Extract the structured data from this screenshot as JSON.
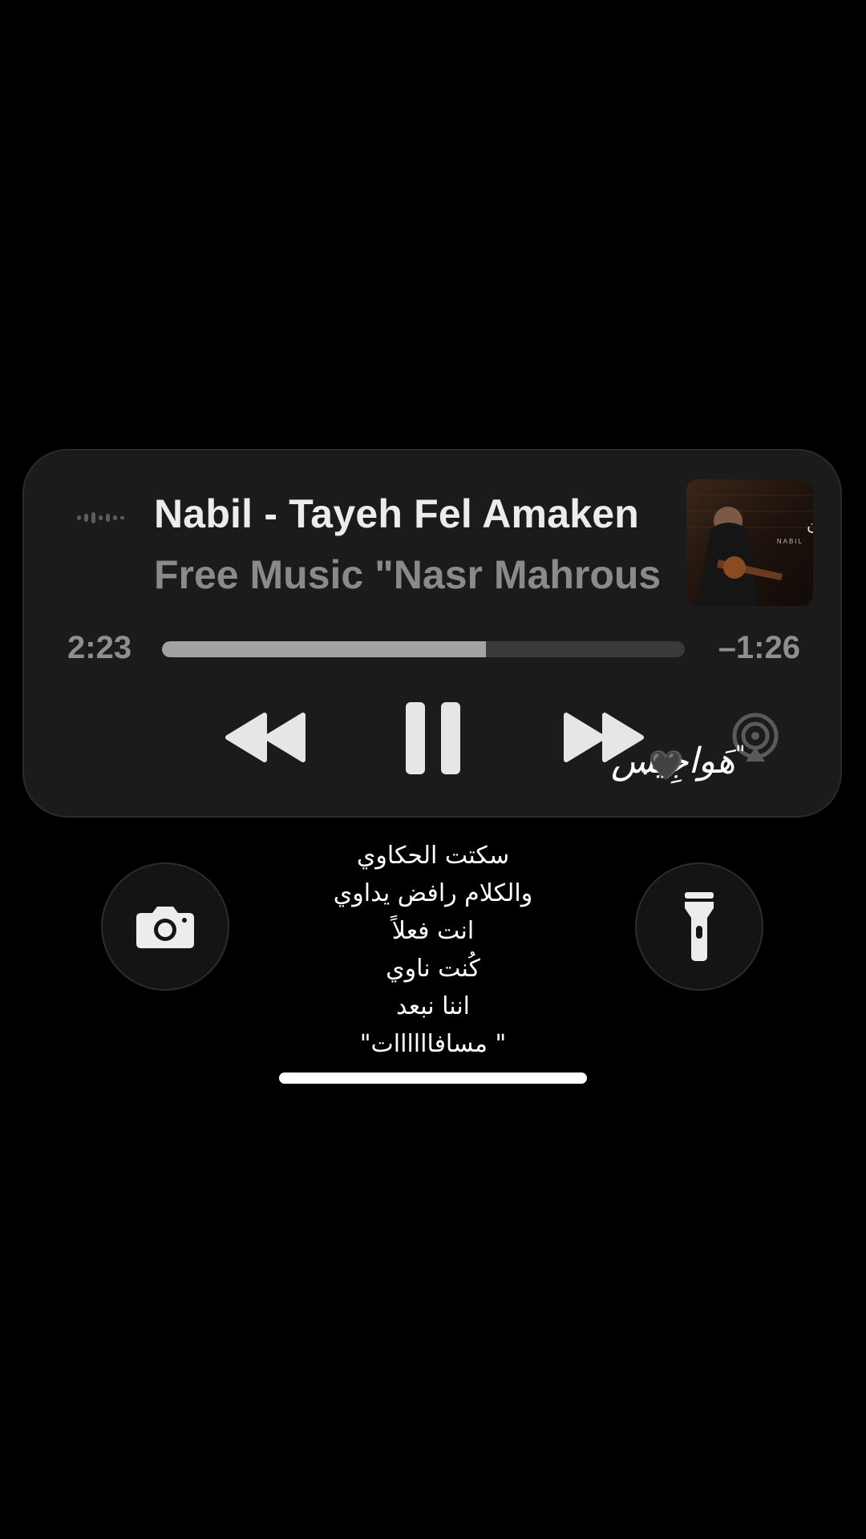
{
  "now_playing": {
    "title": "Nabil - Tayeh Fel Amaken",
    "artist": "Free Music \"Nasr Mahrous",
    "album_art_text": "في الأماكن",
    "album_art_caption": "NABIL",
    "elapsed": "2:23",
    "remaining": "–1:26",
    "progress_fraction": 0.62
  },
  "controls": {
    "rewind_icon": "rewind-icon",
    "pause_icon": "pause-icon",
    "forward_icon": "fast-forward-icon",
    "airplay_icon": "airplay-icon"
  },
  "overlay": {
    "signature": "هَواجِيس",
    "quote_mark": "\"",
    "heart": "🖤",
    "dot": "."
  },
  "quick_actions": {
    "camera_icon": "camera-icon",
    "flashlight_icon": "flashlight-icon"
  },
  "lyrics": [
    "سكتت الحكاوي",
    "والكلام رافض يداوي",
    "انت فعلاً",
    "كُنت ناوي",
    "اننا نبعد",
    "\" مسافاااااات\""
  ],
  "colors": {
    "background": "#000000",
    "card": "#1b1b1b",
    "progress_fill": "#a3a3a3",
    "progress_track": "#3a3a3a",
    "control_icons": "#e6e6e6"
  }
}
